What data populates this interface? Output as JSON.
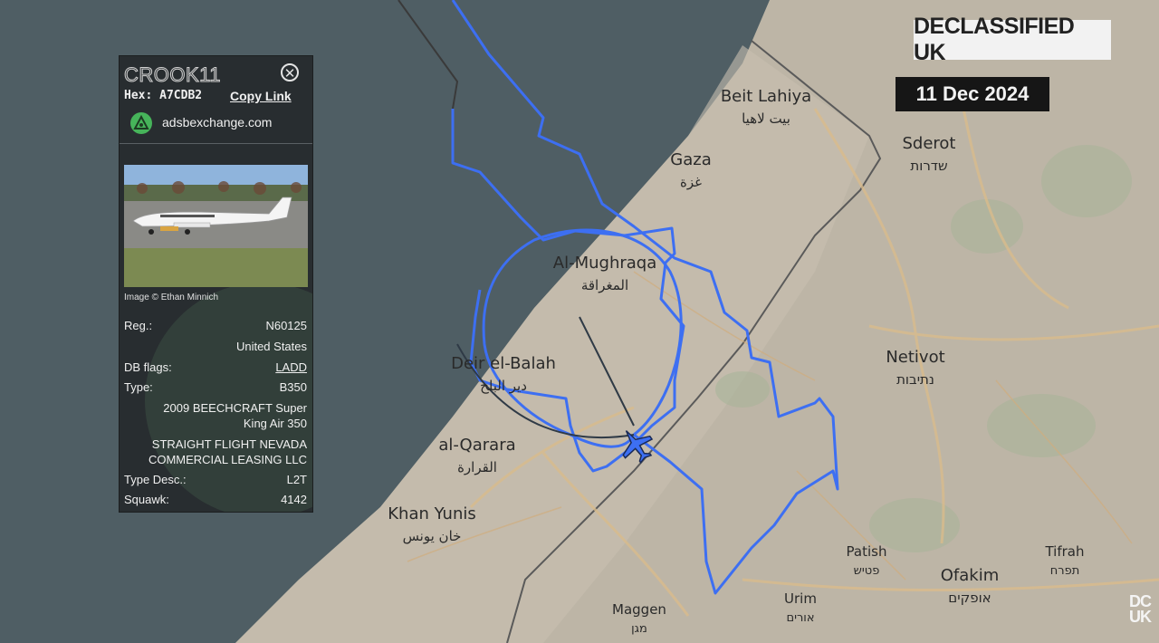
{
  "overlay": {
    "brand": "DECLASSIFIED UK",
    "date": "11 Dec 2024",
    "corner_logo_top": "DC",
    "corner_logo_bottom": "UK"
  },
  "map": {
    "places": [
      {
        "en": "Beit Lahiya",
        "ar": "بيت لاهيا"
      },
      {
        "en": "Gaza",
        "ar": "غزة"
      },
      {
        "en": "Sderot",
        "ar": "שדרות"
      },
      {
        "en": "Al-Mughraqa",
        "ar": "المغراقة"
      },
      {
        "en": "Deir el-Balah",
        "ar": "دير البلح"
      },
      {
        "en": "Netivot",
        "ar": "נתיבות"
      },
      {
        "en": "al-Qarara",
        "ar": "القرارة"
      },
      {
        "en": "Khan Yunis",
        "ar": "خان يونس"
      },
      {
        "en": "Patish",
        "ar": "פטיש"
      },
      {
        "en": "Tifrah",
        "ar": "תפרח"
      },
      {
        "en": "Ofakim",
        "ar": "אופקים"
      },
      {
        "en": "Urim",
        "ar": "אורים"
      },
      {
        "en": "Maggen",
        "ar": "מגן"
      }
    ],
    "colors": {
      "sea": "#4f5e64",
      "land": "#bfb7a8",
      "track": "#3b6ef0",
      "road": "#d8b98a"
    }
  },
  "panel": {
    "callsign": "CROOK11",
    "hex_label": "Hex: A7CDB2",
    "copy_link": "Copy Link",
    "source": "adsbexchange.com",
    "photo_credit": "Image © Ethan Minnich",
    "reg_label": "Reg.:",
    "reg_value": "N60125",
    "country": "United States",
    "dbflags_label": "DB flags:",
    "dbflags_value": "LADD",
    "type_label": "Type:",
    "type_value": "B350",
    "model_line1": "2009 BEECHCRAFT Super",
    "model_line2": "King Air 350",
    "operator_line1": "STRAIGHT FLIGHT NEVADA",
    "operator_line2": "COMMERCIAL LEASING LLC",
    "typedesc_label": "Type Desc.:",
    "typedesc_value": "L2T",
    "squawk_label": "Squawk:",
    "squawk_value": "4142",
    "icons": {
      "close": "close-icon",
      "source": "adsb-source-icon"
    }
  }
}
